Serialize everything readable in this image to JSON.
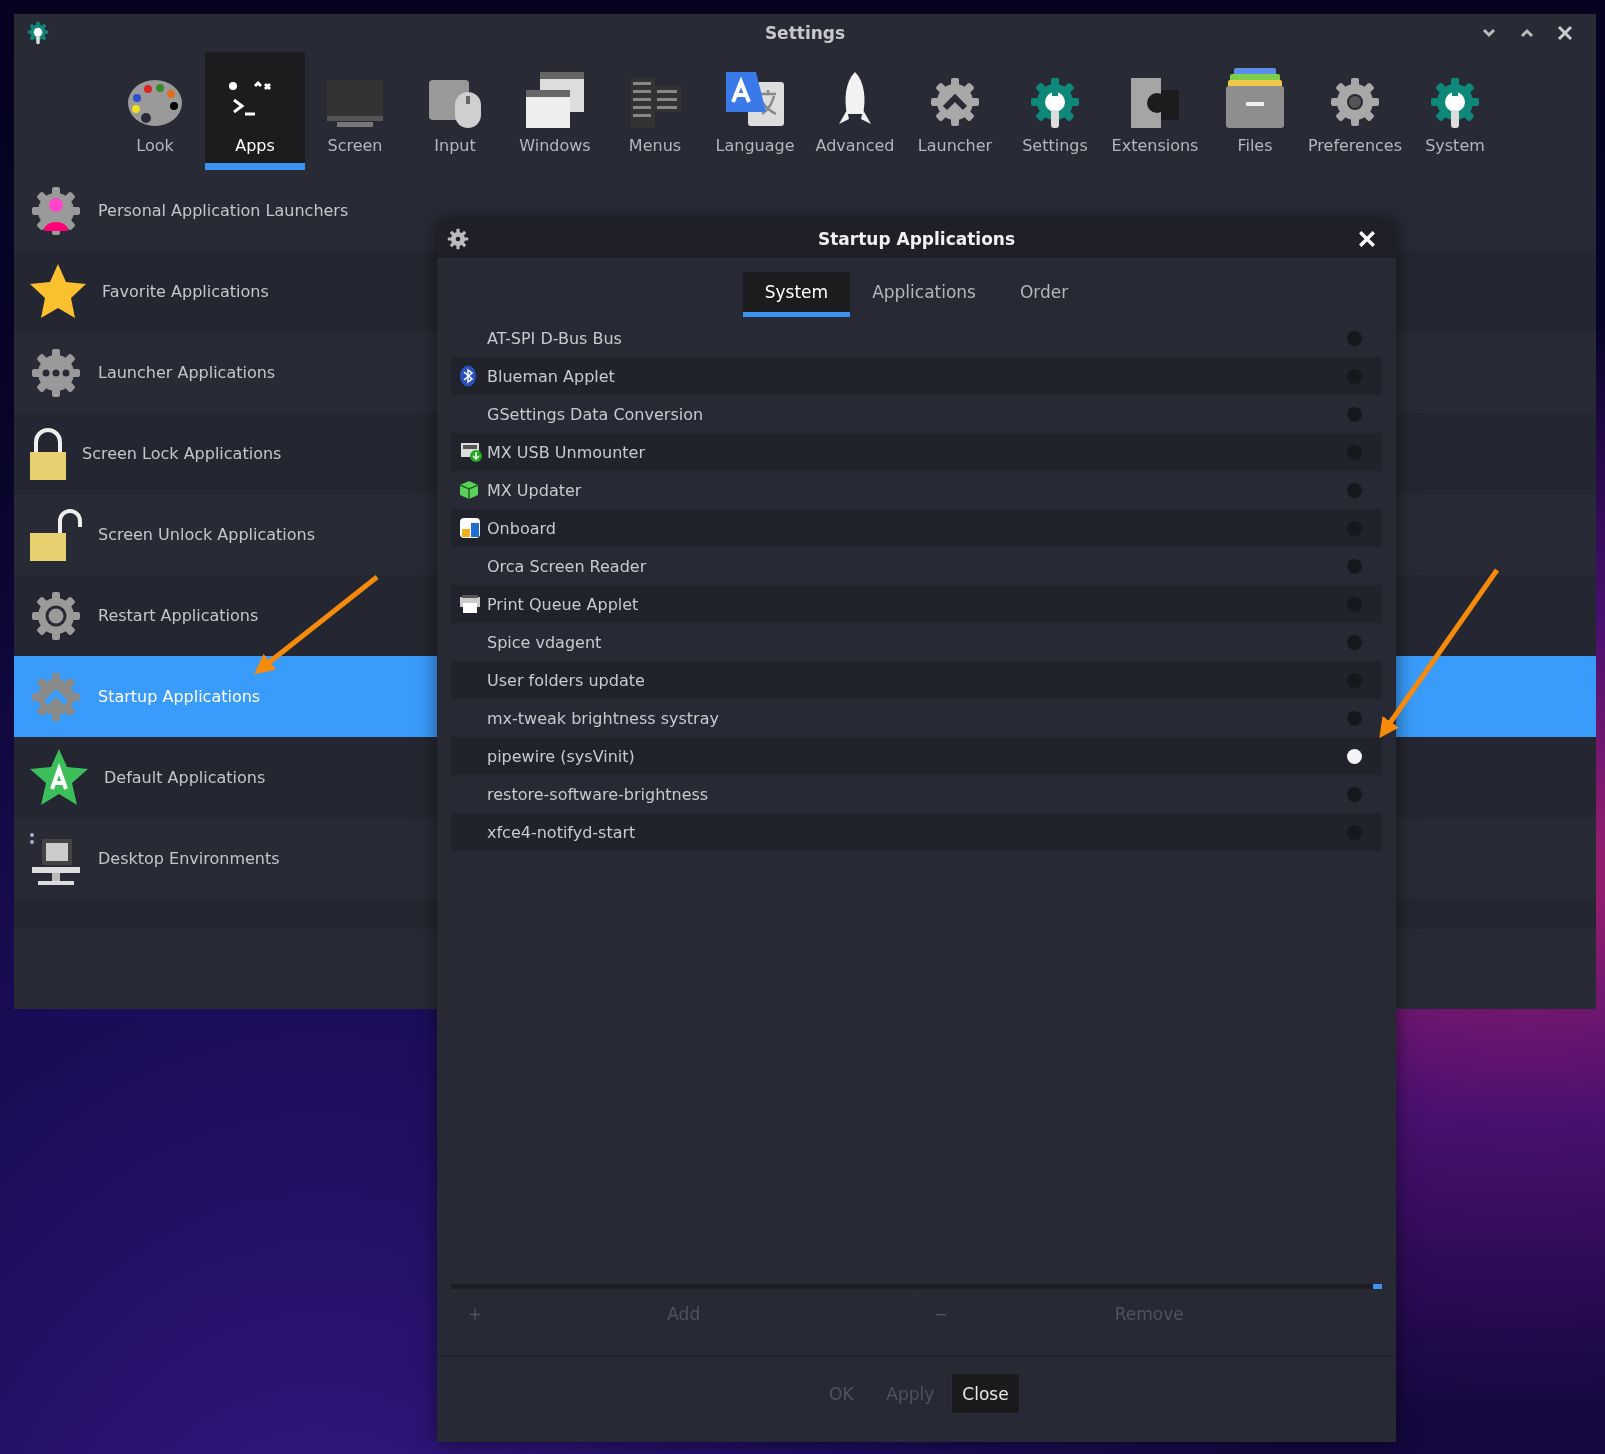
{
  "window": {
    "title": "Settings"
  },
  "toolbar": [
    {
      "label": "Look",
      "selected": false
    },
    {
      "label": "Apps",
      "selected": true
    },
    {
      "label": "Screen",
      "selected": false
    },
    {
      "label": "Input",
      "selected": false
    },
    {
      "label": "Windows",
      "selected": false
    },
    {
      "label": "Menus",
      "selected": false
    },
    {
      "label": "Language",
      "selected": false
    },
    {
      "label": "Advanced",
      "selected": false
    },
    {
      "label": "Launcher",
      "selected": false
    },
    {
      "label": "Settings",
      "selected": false
    },
    {
      "label": "Extensions",
      "selected": false
    },
    {
      "label": "Files",
      "selected": false
    },
    {
      "label": "Preferences",
      "selected": false
    },
    {
      "label": "System",
      "selected": false
    }
  ],
  "sidebar": {
    "items": [
      {
        "label": "Personal Application Launchers",
        "selected": false
      },
      {
        "label": "Favorite Applications",
        "selected": false
      },
      {
        "label": "Launcher Applications",
        "selected": false
      },
      {
        "label": "Screen Lock Applications",
        "selected": false
      },
      {
        "label": "Screen Unlock Applications",
        "selected": false
      },
      {
        "label": "Restart Applications",
        "selected": false
      },
      {
        "label": "Startup Applications",
        "selected": true
      },
      {
        "label": "Default Applications",
        "selected": false
      },
      {
        "label": "Desktop Environments",
        "selected": false
      }
    ]
  },
  "dialog": {
    "title": "Startup Applications",
    "tabs": [
      {
        "label": "System",
        "selected": true
      },
      {
        "label": "Applications",
        "selected": false
      },
      {
        "label": "Order",
        "selected": false
      }
    ],
    "rows": [
      {
        "name": "AT-SPI D-Bus Bus",
        "has_icon": false,
        "checked": false
      },
      {
        "name": "Blueman Applet",
        "has_icon": true,
        "checked": false
      },
      {
        "name": "GSettings Data Conversion",
        "has_icon": false,
        "checked": false
      },
      {
        "name": "MX USB Unmounter",
        "has_icon": true,
        "checked": false
      },
      {
        "name": "MX Updater",
        "has_icon": true,
        "checked": false
      },
      {
        "name": "Onboard",
        "has_icon": true,
        "checked": false
      },
      {
        "name": "Orca Screen Reader",
        "has_icon": false,
        "checked": false
      },
      {
        "name": "Print Queue Applet",
        "has_icon": true,
        "checked": false
      },
      {
        "name": "Spice vdagent",
        "has_icon": false,
        "checked": false
      },
      {
        "name": "User folders update",
        "has_icon": false,
        "checked": false
      },
      {
        "name": "mx-tweak brightness systray",
        "has_icon": false,
        "checked": false
      },
      {
        "name": "pipewire (sysVinit)",
        "has_icon": false,
        "checked": true
      },
      {
        "name": "restore-software-brightness",
        "has_icon": false,
        "checked": false
      },
      {
        "name": "xfce4-notifyd-start",
        "has_icon": false,
        "checked": false
      }
    ],
    "list_actions": [
      {
        "symbol": "+",
        "label": "Add",
        "disabled": true
      },
      {
        "symbol": "−",
        "label": "Remove",
        "disabled": true
      }
    ],
    "buttons": [
      {
        "label": "OK",
        "disabled": true
      },
      {
        "label": "Apply",
        "disabled": true
      },
      {
        "label": "Close",
        "disabled": false
      }
    ]
  }
}
